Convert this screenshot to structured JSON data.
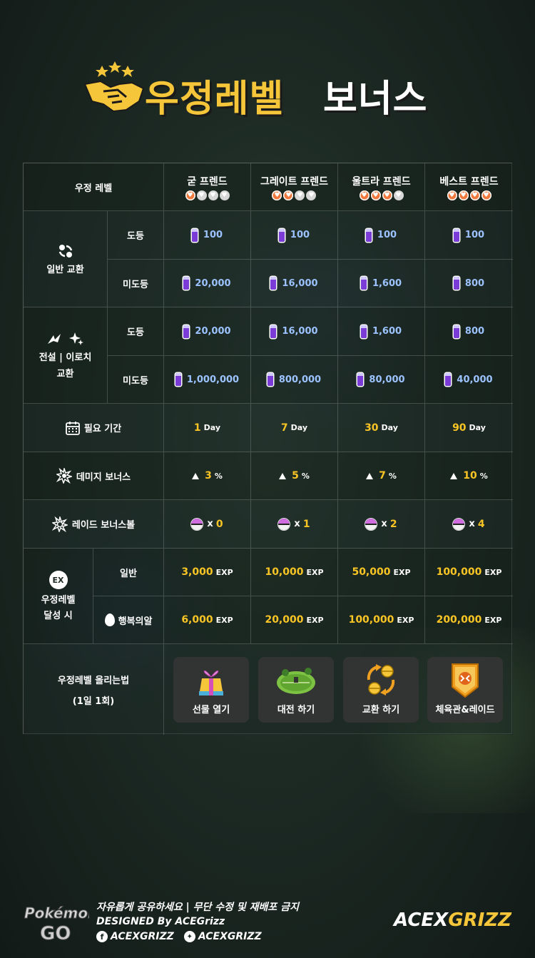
{
  "title": {
    "main": "우정레벨",
    "sub": "보너스"
  },
  "colors": {
    "accent_yellow": "#f9c525",
    "heart_on": "#f07a3e",
    "candy_purple": "#7a3bd6",
    "number_blue": "#9cc3ff"
  },
  "header": {
    "friendship_level": "우정 레벨",
    "levels": [
      {
        "name": "굳 프렌드",
        "hearts_filled": 1
      },
      {
        "name": "그레이트 프렌드",
        "hearts_filled": 2
      },
      {
        "name": "울트라 프렌드",
        "hearts_filled": 3
      },
      {
        "name": "베스트 프렌드",
        "hearts_filled": 4
      }
    ]
  },
  "normal_trade": {
    "label": "일반 교환",
    "icon": "trade-icon",
    "registered_label": "도등",
    "unregistered_label": "미도등",
    "registered": [
      "100",
      "100",
      "100",
      "100"
    ],
    "unregistered": [
      "20,000",
      "16,000",
      "1,600",
      "800"
    ]
  },
  "special_trade": {
    "label_line1": "전설 | 이로치",
    "label_line2": "교환",
    "icon": "legendary-shiny-icon",
    "registered_label": "도등",
    "unregistered_label": "미도등",
    "registered": [
      "20,000",
      "16,000",
      "1,600",
      "800"
    ],
    "unregistered": [
      "1,000,000",
      "800,000",
      "80,000",
      "40,000"
    ]
  },
  "required_period": {
    "label": "필요 기간",
    "icon": "calendar-icon",
    "values": [
      "1",
      "7",
      "30",
      "90"
    ],
    "unit": "Day"
  },
  "damage_bonus": {
    "label": "데미지 보너스",
    "icon": "damage-icon",
    "values": [
      "3",
      "5",
      "7",
      "10"
    ],
    "unit": "%"
  },
  "raid_bonus_ball": {
    "label": "레이드 보너스볼",
    "icon": "raid-icon",
    "values": [
      "0",
      "1",
      "2",
      "4"
    ],
    "prefix": "x"
  },
  "level_up_exp": {
    "label_line1": "우정레벨",
    "label_line2": "달성 시",
    "icon": "ex-icon",
    "normal_label": "일반",
    "lucky_egg_label": "행복의알",
    "normal": [
      "3,000",
      "10,000",
      "50,000",
      "100,000"
    ],
    "lucky_egg": [
      "6,000",
      "20,000",
      "100,000",
      "200,000"
    ],
    "unit": "EXP"
  },
  "how_to_raise": {
    "label_line1": "우정레벨 올리는법",
    "label_line2": "(1일 1회)",
    "methods": [
      {
        "label": "선물 열기",
        "icon": "gift-icon"
      },
      {
        "label": "대전 하기",
        "icon": "battle-arena-icon"
      },
      {
        "label": "교환 하기",
        "icon": "trade-arrows-icon"
      },
      {
        "label": "체육관&레이드",
        "icon": "gym-badge-icon"
      }
    ]
  },
  "footer": {
    "line1": "자유롭게 공유하세요  |   무단 수정 및 재배포 금지",
    "line2": "DESIGNED By ACEGrizz",
    "facebook": "ACEXGRIZZ",
    "twitter": "ACEXGRIZZ",
    "logo_left": "Pokémon GO",
    "logo_right_a": "ACEX",
    "logo_right_b": "GRIZZ"
  }
}
